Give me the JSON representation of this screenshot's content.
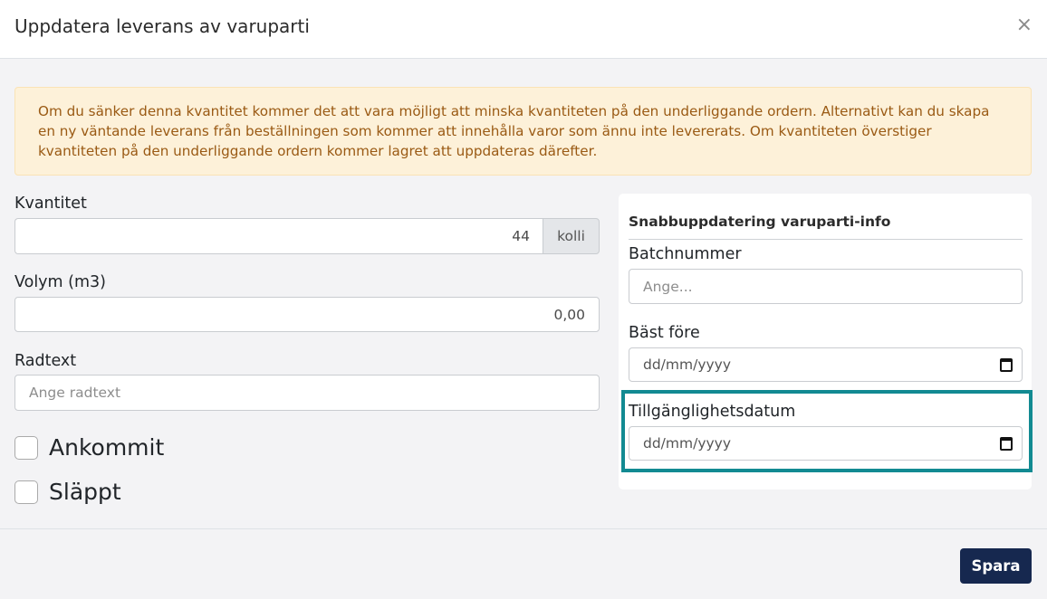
{
  "dialog": {
    "title": "Uppdatera leverans av varuparti",
    "close_label": "×"
  },
  "alert": {
    "text": "Om du sänker denna kvantitet kommer det att vara möjligt att minska kvantiteten på den underliggande ordern. Alternativt kan du skapa en ny väntande leverans från beställningen som kommer att innehålla varor som ännu inte levererats. Om kvantiteten överstiger kvantiteten på den underliggande ordern kommer lagret att uppdateras därefter."
  },
  "form": {
    "quantity": {
      "label": "Kvantitet",
      "value": "44",
      "unit": "kolli"
    },
    "volume": {
      "label": "Volym (m3)",
      "value": "0,00"
    },
    "rowtext": {
      "label": "Radtext",
      "placeholder": "Ange radtext"
    },
    "arrived": {
      "label": "Ankommit",
      "checked": false
    },
    "released": {
      "label": "Släppt",
      "checked": false
    }
  },
  "quick_update": {
    "title": "Snabbuppdatering varuparti-info",
    "batch": {
      "label": "Batchnummer",
      "placeholder": "Ange..."
    },
    "best_before": {
      "label": "Bäst före",
      "placeholder": "dd/mm/yyyy"
    },
    "availability": {
      "label": "Tillgänglighetsdatum",
      "placeholder": "dd/mm/yyyy"
    }
  },
  "footer": {
    "save_label": "Spara"
  },
  "colors": {
    "primary": "#16284f",
    "highlight": "#128a92",
    "alert_bg": "#fdf1d9",
    "alert_text": "#9a5a14"
  },
  "icons": {
    "close": "close-icon",
    "calendar": "calendar-icon"
  }
}
